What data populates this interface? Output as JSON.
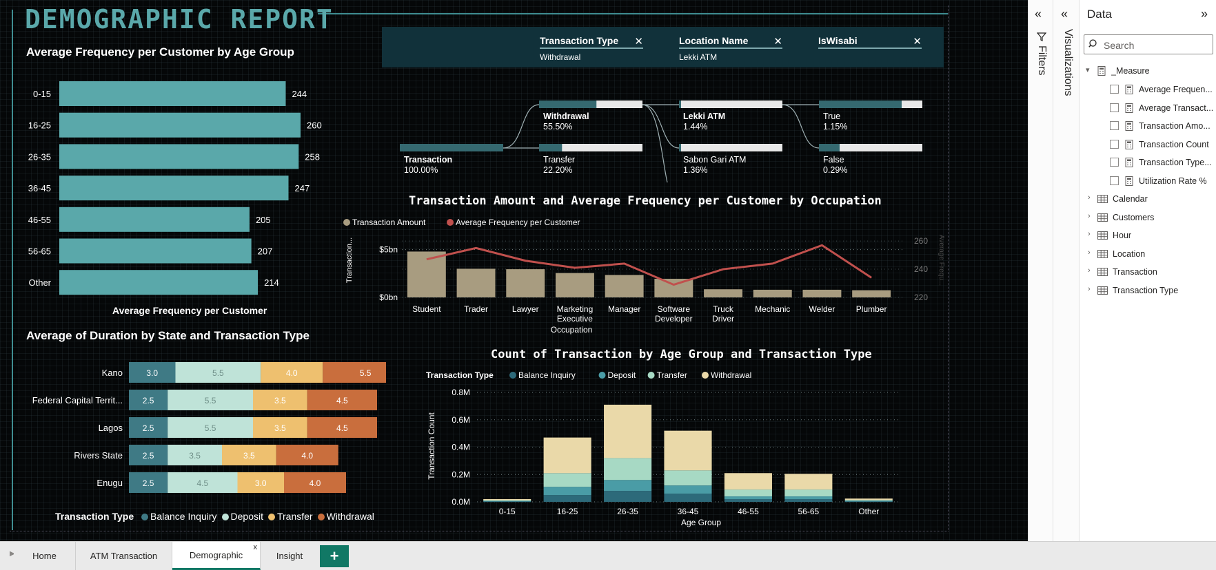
{
  "report": {
    "title": "DEMOGRAPHIC REPORT"
  },
  "colors": {
    "teal_bar": "#5aa8aa",
    "balance_inquiry": "#3f7a85",
    "deposit": "#bfe3d8",
    "transfer": "#eec06f",
    "withdrawal": "#c96e3d",
    "count_balance": "#2d6a7a",
    "count_deposit": "#4a9ca6",
    "count_transfer": "#a7d9c4",
    "count_withdrawal": "#ead9a9",
    "amount_bar": "#a89c80",
    "freq_line": "#c0504d"
  },
  "filters": [
    {
      "name": "Transaction Type",
      "value": "Withdrawal",
      "close": "✕"
    },
    {
      "name": "Location Name",
      "value": "Lekki ATM",
      "close": "✕"
    },
    {
      "name": "IsWisabi",
      "value": "",
      "close": "✕"
    }
  ],
  "decomp": {
    "root": {
      "label": "Transaction",
      "value": "100.00%",
      "fill": 1.0
    },
    "level1": [
      {
        "label": "Withdrawal",
        "value": "55.50%",
        "fill": 0.555,
        "bold": true
      },
      {
        "label": "Transfer",
        "value": "22.20%",
        "fill": 0.222,
        "bold": false
      }
    ],
    "level2": [
      {
        "label": "Lekki ATM",
        "value": "1.44%",
        "fill": 0.02,
        "bold": true
      },
      {
        "label": "Sabon Gari ATM",
        "value": "1.36%",
        "fill": 0.019,
        "bold": false
      }
    ],
    "level3": [
      {
        "label": "True",
        "value": "1.15%",
        "fill": 0.8,
        "bold": false
      },
      {
        "label": "False",
        "value": "0.29%",
        "fill": 0.2,
        "bold": false
      }
    ]
  },
  "chart_data": [
    {
      "type": "bar",
      "title": "Average Frequency per Customer by Age Group",
      "xlabel": "Average Frequency per Customer",
      "ylabel": "",
      "orientation": "horizontal",
      "categories": [
        "0-15",
        "16-25",
        "26-35",
        "36-45",
        "46-55",
        "56-65",
        "Other"
      ],
      "values": [
        244,
        260,
        258,
        247,
        205,
        207,
        214
      ]
    },
    {
      "type": "bar",
      "title": "Average of Duration by State and Transaction Type",
      "orientation": "horizontal",
      "stacked": true,
      "legend_title": "Transaction Type",
      "legend_position": "bottom",
      "categories": [
        "Kano",
        "Federal Capital Territ...",
        "Lagos",
        "Rivers State",
        "Enugu"
      ],
      "series": [
        {
          "name": "Balance Inquiry",
          "values": [
            3.0,
            2.5,
            2.5,
            2.5,
            2.5
          ],
          "labels": [
            "3.0",
            "2.5",
            "2.5",
            "2.5",
            "2.5"
          ]
        },
        {
          "name": "Deposit",
          "values": [
            5.5,
            5.5,
            5.5,
            3.5,
            4.5
          ],
          "labels": [
            "5.5",
            "5.5",
            "5.5",
            "3.5",
            "4.5"
          ]
        },
        {
          "name": "Transfer",
          "values": [
            4.0,
            3.5,
            3.5,
            3.5,
            3.0
          ],
          "labels": [
            "4.0",
            "3.5",
            "3.5",
            "3.5",
            "3.0"
          ]
        },
        {
          "name": "Withdrawal",
          "values": [
            5.5,
            4.5,
            4.5,
            4.0,
            4.0
          ],
          "labels": [
            "5.5",
            "4.5",
            "4.5",
            "4.0",
            "4.0"
          ]
        }
      ]
    },
    {
      "type": "bar",
      "combo": "bar+line",
      "title": "Transaction Amount and Average Frequency per Customer by Occupation",
      "xlabel": "Occupation",
      "ylabel": "Transaction...",
      "y2label": "Average Frequ...",
      "legend_position": "top-left",
      "categories": [
        "Student",
        "Trader",
        "Lawyer",
        "Marketing Executive",
        "Manager",
        "Software Developer",
        "Truck Driver",
        "Mechanic",
        "Welder",
        "Plumber"
      ],
      "y_ticks": [
        "$0bn",
        "$5bn"
      ],
      "y2_ticks": [
        "220",
        "240",
        "260"
      ],
      "ylim": [
        0,
        6.2
      ],
      "y2lim": [
        220,
        262
      ],
      "series": [
        {
          "name": "Transaction Amount",
          "type": "bar",
          "values": [
            4.8,
            3.0,
            2.95,
            2.55,
            2.35,
            1.95,
            0.85,
            0.8,
            0.8,
            0.75
          ]
        },
        {
          "name": "Average Frequency per Customer",
          "type": "line",
          "values": [
            247,
            255,
            246,
            241,
            244,
            229,
            240,
            244,
            257,
            234
          ]
        }
      ]
    },
    {
      "type": "bar",
      "stacked": true,
      "title": "Count of Transaction by Age Group and Transaction Type",
      "xlabel": "Age Group",
      "ylabel": "Transaction Count",
      "legend_title": "Transaction Type",
      "legend_position": "top",
      "categories": [
        "0-15",
        "16-25",
        "26-35",
        "36-45",
        "46-55",
        "56-65",
        "Other"
      ],
      "y_ticks": [
        "0.0M",
        "0.2M",
        "0.4M",
        "0.6M",
        "0.8M"
      ],
      "ylim": [
        0,
        0.8
      ],
      "series": [
        {
          "name": "Balance Inquiry",
          "values": [
            0.004,
            0.05,
            0.08,
            0.06,
            0.02,
            0.02,
            0.004
          ]
        },
        {
          "name": "Deposit",
          "values": [
            0.004,
            0.06,
            0.08,
            0.06,
            0.02,
            0.02,
            0.004
          ]
        },
        {
          "name": "Transfer",
          "values": [
            0.004,
            0.1,
            0.16,
            0.11,
            0.05,
            0.05,
            0.006
          ]
        },
        {
          "name": "Withdrawal",
          "values": [
            0.008,
            0.26,
            0.39,
            0.29,
            0.12,
            0.115,
            0.01
          ]
        }
      ]
    }
  ],
  "panes": {
    "filters": {
      "label": "Filters"
    },
    "visualizations": {
      "label": "Visualizations"
    },
    "data": {
      "title": "Data",
      "search_placeholder": "Search",
      "measure_table": "_Measure",
      "measures": [
        "Average Frequen...",
        "Average Transact...",
        "Transaction Amo...",
        "Transaction Count",
        "Transaction Type...",
        "Utilization Rate %"
      ],
      "tables": [
        "Calendar",
        "Customers",
        "Hour",
        "Location",
        "Transaction",
        "Transaction Type"
      ]
    }
  },
  "tabs": [
    {
      "label": "Home",
      "active": false
    },
    {
      "label": "ATM Transaction",
      "active": false
    },
    {
      "label": "Demographic",
      "active": true,
      "close": "x"
    },
    {
      "label": "Insight",
      "active": false
    }
  ],
  "add_tab": "+"
}
